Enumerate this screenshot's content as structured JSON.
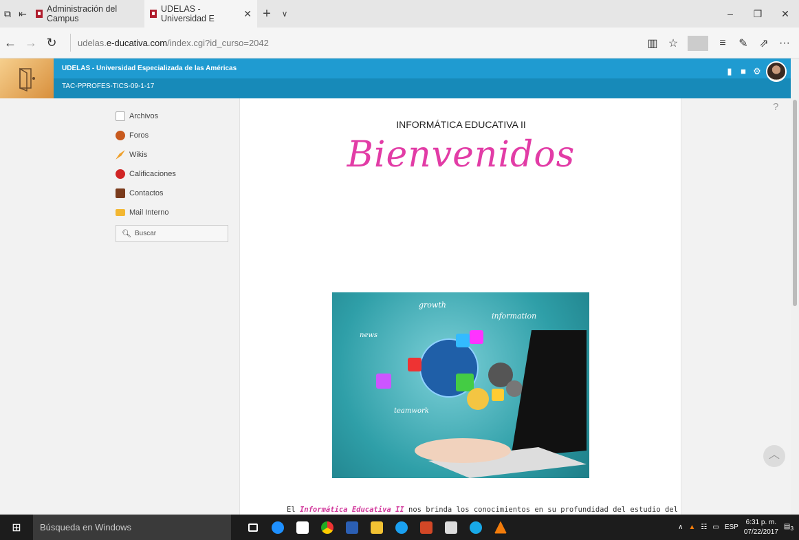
{
  "browser": {
    "tabs": [
      {
        "label": "Administración del Campus"
      },
      {
        "label": "UDELAS - Universidad E"
      }
    ],
    "url_prefix": "udelas.",
    "url_domain": "e-ducativa.com",
    "url_path": "/index.cgi?id_curso=2042"
  },
  "site": {
    "institution": "UDELAS - Universidad Especializada de las Américas",
    "course_code": "TAC-PPROFES-TICS-09-1-17"
  },
  "menu": {
    "items": [
      {
        "label": "Archivos"
      },
      {
        "label": "Foros"
      },
      {
        "label": "Wikis"
      },
      {
        "label": "Calificaciones"
      },
      {
        "label": "Contactos"
      },
      {
        "label": "Mail Interno"
      }
    ],
    "search_label": "Buscar"
  },
  "content": {
    "title": "INFORMÁTICA EDUCATIVA II",
    "welcome": "Bienvenidos",
    "banner_words": [
      "growth",
      "information",
      "news",
      "teamwork"
    ],
    "para_start": "El ",
    "para_em": "Informática Educativa II",
    "para_rest": " nos brinda los conocimientos en su profundidad del estudio del software"
  },
  "help": "?",
  "taskbar": {
    "search": "Búsqueda en Windows",
    "lang": "ESP",
    "time": "6:31 p. m.",
    "date": "07/22/2017",
    "notif_count": "3"
  }
}
